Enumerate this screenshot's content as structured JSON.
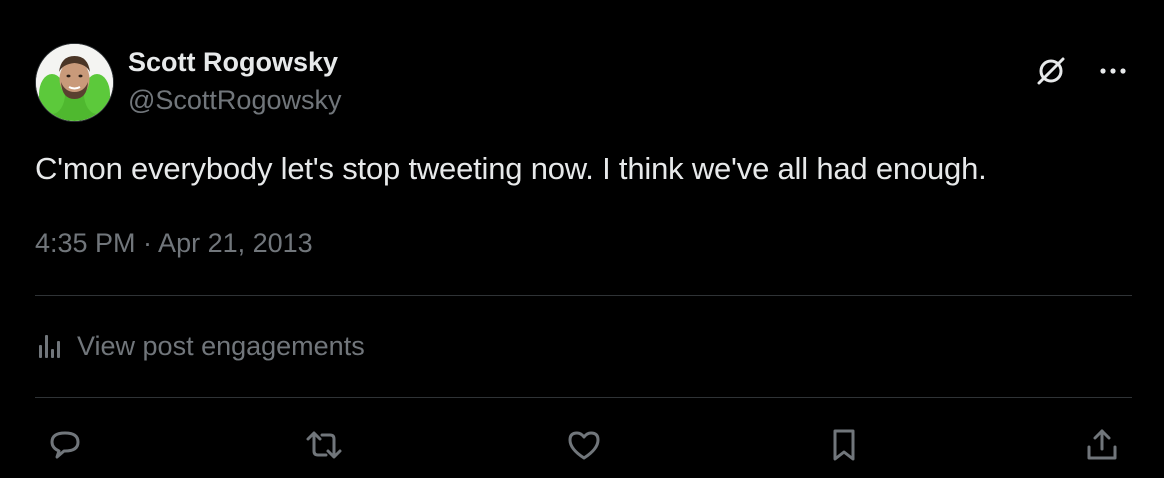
{
  "author": {
    "name": "Scott Rogowsky",
    "handle": "@ScottRogowsky",
    "avatar_icon": "profile-photo"
  },
  "post": {
    "text": "C'mon everybody let's stop tweeting now. I think we've all had enough.",
    "timestamp": "4:35 PM · Apr 21, 2013"
  },
  "engagements": {
    "label": "View post engagements",
    "icon": "analytics-bars-icon"
  },
  "header_actions": [
    {
      "name": "grok",
      "icon": "grok-icon"
    },
    {
      "name": "more",
      "icon": "more-dots-icon"
    }
  ],
  "actions": [
    {
      "name": "reply",
      "icon": "reply-icon"
    },
    {
      "name": "repost",
      "icon": "repost-icon"
    },
    {
      "name": "like",
      "icon": "heart-icon"
    },
    {
      "name": "bookmark",
      "icon": "bookmark-icon"
    },
    {
      "name": "share",
      "icon": "share-icon"
    }
  ],
  "colors": {
    "background": "#000000",
    "primary_text": "#e7e9ea",
    "secondary_text": "#71767b",
    "divider": "#2f3336",
    "avatar_accent": "#5cc93b"
  }
}
